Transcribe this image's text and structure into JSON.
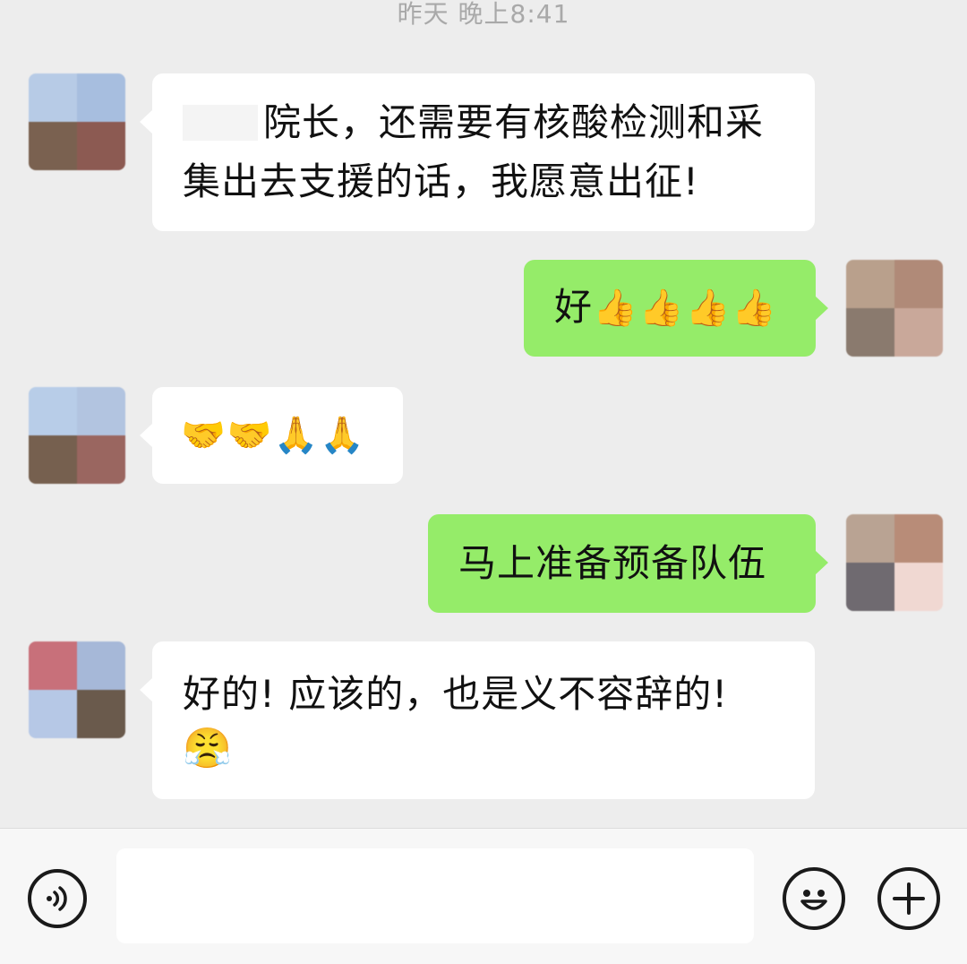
{
  "timestamp": "昨天 晚上8:41",
  "messages": [
    {
      "direction": "incoming",
      "redacted_name": true,
      "line1": "院长，还需要有核酸检测和采",
      "line2": "集出去支援的话，我愿意出征!"
    },
    {
      "direction": "outgoing",
      "text": "好",
      "emoji": "👍👍👍👍"
    },
    {
      "direction": "incoming",
      "emoji": "🤝🤝🙏🙏"
    },
    {
      "direction": "outgoing",
      "text": "马上准备预备队伍"
    },
    {
      "direction": "incoming",
      "text": "好的! 应该的，也是义不容辞的!",
      "emoji": "😤"
    }
  ],
  "input_bar": {
    "voice_icon": "voice-icon",
    "emoji_icon": "emoji-icon",
    "plus_icon": "plus-icon"
  },
  "colors": {
    "background": "#ededed",
    "incoming_bubble": "#ffffff",
    "outgoing_bubble": "#95ec69"
  }
}
